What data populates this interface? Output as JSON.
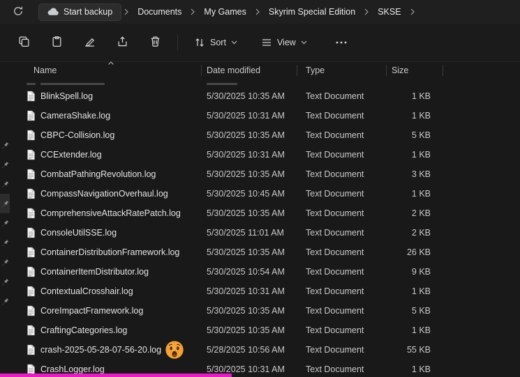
{
  "address_bar": {
    "backup_button": "Start backup",
    "breadcrumbs": [
      "Documents",
      "My Games",
      "Skyrim Special Edition",
      "SKSE"
    ]
  },
  "toolbar": {
    "sort": "Sort",
    "view": "View"
  },
  "list": {
    "columns": {
      "name": "Name",
      "date": "Date modified",
      "type": "Type",
      "size": "Size"
    },
    "sort_direction": "ascending",
    "files": [
      {
        "name": "BlinkSpell.log",
        "date": "5/30/2025 10:35 AM",
        "type": "Text Document",
        "size": "1 KB"
      },
      {
        "name": "CameraShake.log",
        "date": "5/30/2025 10:31 AM",
        "type": "Text Document",
        "size": "1 KB"
      },
      {
        "name": "CBPC-Collision.log",
        "date": "5/30/2025 10:35 AM",
        "type": "Text Document",
        "size": "5 KB"
      },
      {
        "name": "CCExtender.log",
        "date": "5/30/2025 10:31 AM",
        "type": "Text Document",
        "size": "1 KB"
      },
      {
        "name": "CombatPathingRevolution.log",
        "date": "5/30/2025 10:35 AM",
        "type": "Text Document",
        "size": "3 KB"
      },
      {
        "name": "CompassNavigationOverhaul.log",
        "date": "5/30/2025 10:45 AM",
        "type": "Text Document",
        "size": "1 KB"
      },
      {
        "name": "ComprehensiveAttackRatePatch.log",
        "date": "5/30/2025 10:35 AM",
        "type": "Text Document",
        "size": "2 KB"
      },
      {
        "name": "ConsoleUtilSSE.log",
        "date": "5/30/2025 11:01 AM",
        "type": "Text Document",
        "size": "2 KB"
      },
      {
        "name": "ContainerDistributionFramework.log",
        "date": "5/30/2025 10:35 AM",
        "type": "Text Document",
        "size": "26 KB"
      },
      {
        "name": "ContainerItemDistributor.log",
        "date": "5/30/2025 10:54 AM",
        "type": "Text Document",
        "size": "9 KB"
      },
      {
        "name": "ContextualCrosshair.log",
        "date": "5/30/2025 10:31 AM",
        "type": "Text Document",
        "size": "1 KB"
      },
      {
        "name": "CoreImpactFramework.log",
        "date": "5/30/2025 10:35 AM",
        "type": "Text Document",
        "size": "5 KB"
      },
      {
        "name": "CraftingCategories.log",
        "date": "5/30/2025 10:35 AM",
        "type": "Text Document",
        "size": "1 KB"
      },
      {
        "name": "crash-2025-05-28-07-56-20.log",
        "date": "5/28/2025 10:56 AM",
        "type": "Text Document",
        "size": "55 KB",
        "emoji": true
      },
      {
        "name": "CrashLogger.log",
        "date": "5/30/2025 10:31 AM",
        "type": "Text Document",
        "size": "1 KB"
      }
    ]
  },
  "nav_pins": {
    "count": 9,
    "highlighted_index": 3
  },
  "icons": {
    "refresh": "refresh-icon",
    "backup": "cloud-icon",
    "breadcrumb_separator": "chevron-right-icon",
    "toolbar": [
      "copy-icon",
      "paste-icon",
      "rename-icon",
      "share-icon",
      "delete-icon"
    ],
    "sort": "sort-arrows-icon",
    "view": "view-list-icon",
    "more": "more-ellipsis-icon",
    "file": "text-document-icon",
    "pin": "pin-icon",
    "overlay": "surprised-emoji"
  },
  "colors": {
    "magenta_bar": "#e81bc7",
    "emoji_face": "#f5a033",
    "background": "#191919",
    "chrome": "#1f1f1f"
  }
}
